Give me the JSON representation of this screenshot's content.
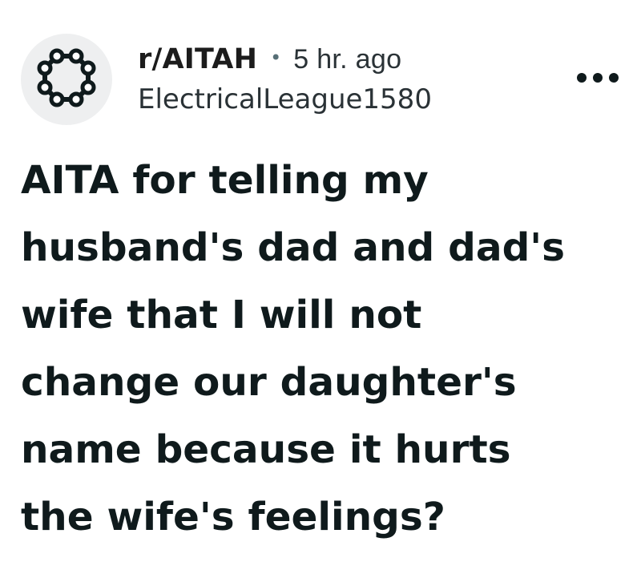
{
  "post": {
    "subreddit": "r/AITAH",
    "separator": "•",
    "time_ago": "5 hr. ago",
    "author": "ElectricalLeague1580",
    "title_lines": [
      "AITA for telling my",
      "husband's dad and dad's",
      "wife that I will not",
      "change our daughter's",
      "name because it hurts",
      "the wife's feelings?"
    ]
  },
  "icons": {
    "avatar": "subreddit-community-icon",
    "more": "more-options-icon"
  },
  "colors": {
    "avatar_background": "#eeeff0",
    "text_primary": "#0f1a1c",
    "text_secondary": "#2a3236"
  }
}
